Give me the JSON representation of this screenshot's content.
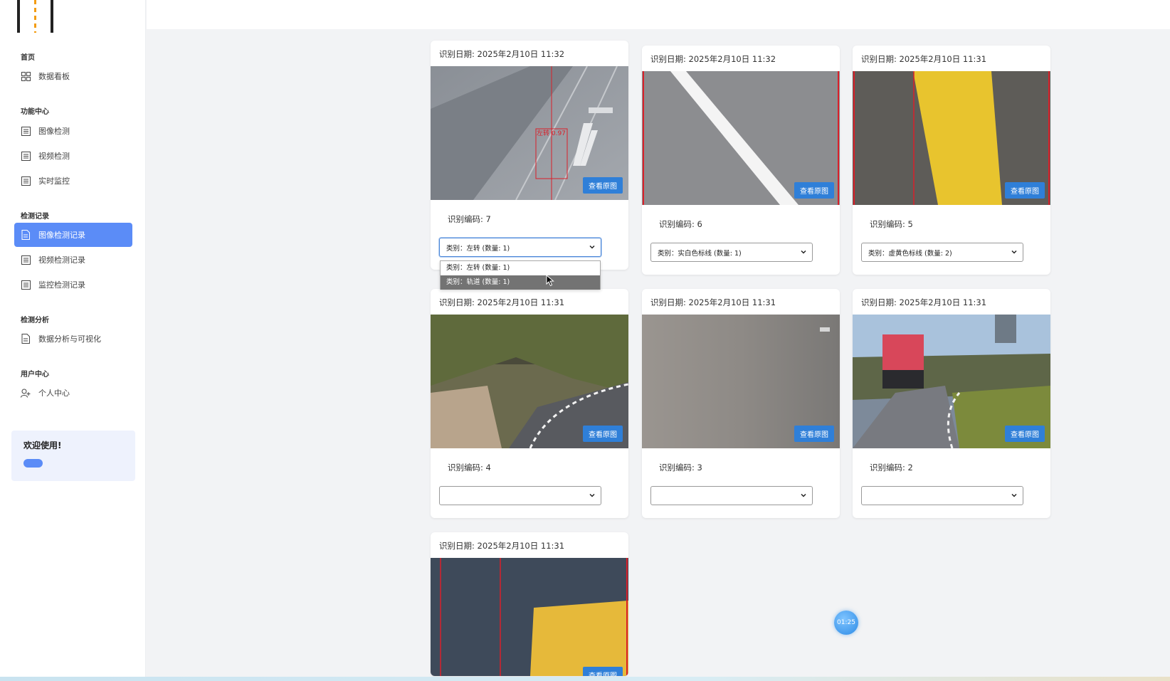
{
  "sidebar": {
    "sections": [
      {
        "title": "首页",
        "items": [
          {
            "label": "数据看板",
            "icon": "grid-icon"
          }
        ]
      },
      {
        "title": "功能中心",
        "items": [
          {
            "label": "图像检测",
            "icon": "list-icon"
          },
          {
            "label": "视频检测",
            "icon": "list-icon"
          },
          {
            "label": "实时监控",
            "icon": "list-icon"
          }
        ]
      },
      {
        "title": "检测记录",
        "items": [
          {
            "label": "图像检测记录",
            "icon": "document-icon",
            "active": true
          },
          {
            "label": "视频检测记录",
            "icon": "list-icon"
          },
          {
            "label": "监控检测记录",
            "icon": "list-icon"
          }
        ]
      },
      {
        "title": "检测分析",
        "items": [
          {
            "label": "数据分析与可视化",
            "icon": "document-icon"
          }
        ]
      },
      {
        "title": "用户中心",
        "items": [
          {
            "label": "个人中心",
            "icon": "user-add-icon"
          }
        ]
      }
    ],
    "welcome": "欢迎使用!"
  },
  "view_button_label": "查看原图",
  "cards": [
    {
      "date": "识别日期: 2025年2月10日 11:32",
      "code": "识别编码: 7",
      "select": "类别：左转 (数量: 1)",
      "detection_label": "左转 0.97"
    },
    {
      "date": "识别日期: 2025年2月10日 11:32",
      "code": "识别编码: 6",
      "select": "类别：实白色标线 (数量: 1)"
    },
    {
      "date": "识别日期: 2025年2月10日 11:31",
      "code": "识别编码: 5",
      "select": "类别：虚黄色标线 (数量: 2)"
    },
    {
      "date": "识别日期: 2025年2月10日 11:31",
      "code": "识别编码: 4",
      "select": ""
    },
    {
      "date": "识别日期: 2025年2月10日 11:31",
      "code": "识别编码: 3",
      "select": ""
    },
    {
      "date": "识别日期: 2025年2月10日 11:31",
      "code": "识别编码: 2",
      "select": ""
    },
    {
      "date": "识别日期: 2025年2月10日 11:31"
    }
  ],
  "dropdown_options": [
    "类别：左转 (数量: 1)",
    "类别：轨道 (数量: 1)"
  ],
  "timer": "01:25",
  "colors": {
    "accent": "#5b8cf7",
    "button": "#2f7fd8",
    "detection_box": "#d9202a"
  }
}
